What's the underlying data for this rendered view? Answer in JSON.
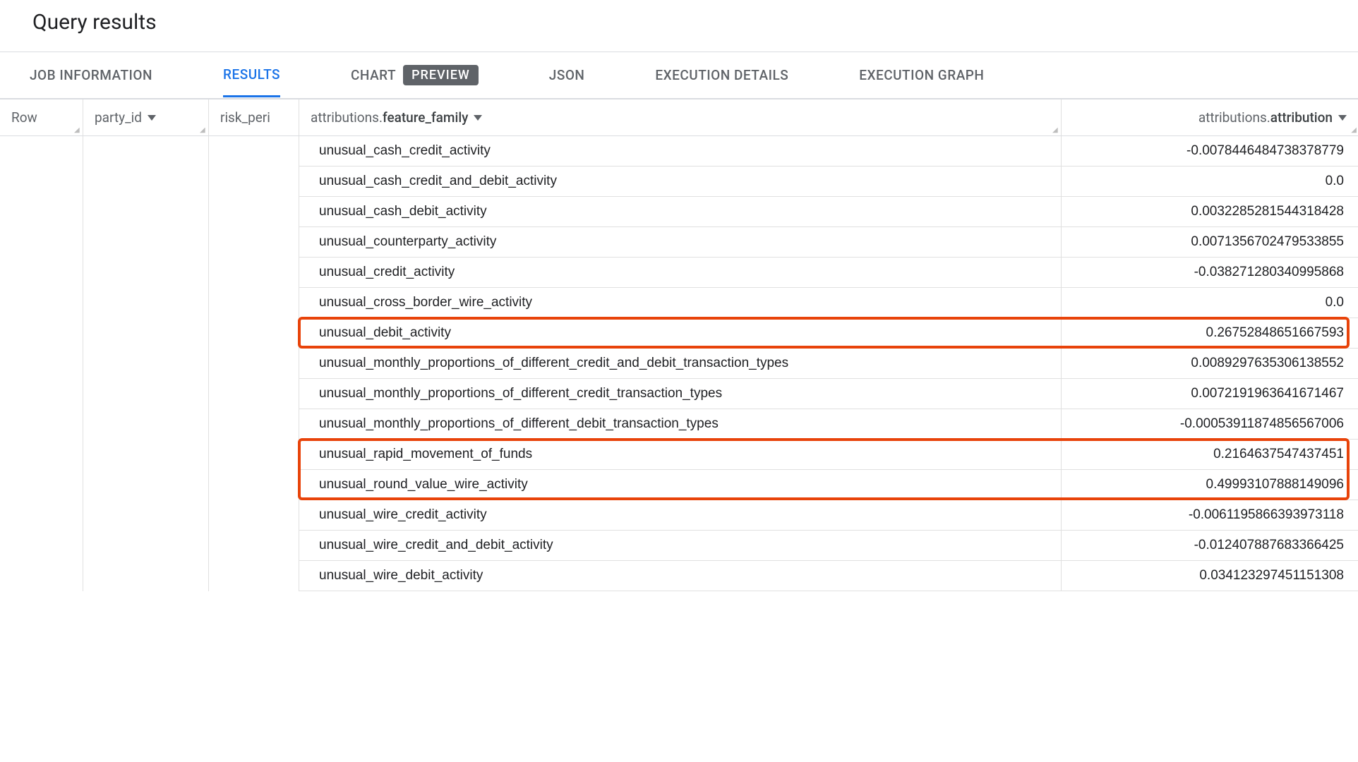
{
  "title": "Query results",
  "tabs": {
    "job_information": "JOB INFORMATION",
    "results": "RESULTS",
    "chart": "CHART",
    "preview_badge": "PREVIEW",
    "json": "JSON",
    "execution_details": "EXECUTION DETAILS",
    "execution_graph": "EXECUTION GRAPH"
  },
  "columns": {
    "row": "Row",
    "party_id": "party_id",
    "risk_peri": "risk_peri",
    "feature_family_prefix": "attributions.",
    "feature_family_bold": "feature_family",
    "attribution_prefix": "attributions.",
    "attribution_bold": "attribution"
  },
  "rows": [
    {
      "feature": "unusual_cash_credit_activity",
      "attr": "-0.0078446484738378779"
    },
    {
      "feature": "unusual_cash_credit_and_debit_activity",
      "attr": "0.0"
    },
    {
      "feature": "unusual_cash_debit_activity",
      "attr": "0.0032285281544318428"
    },
    {
      "feature": "unusual_counterparty_activity",
      "attr": "0.0071356702479533855"
    },
    {
      "feature": "unusual_credit_activity",
      "attr": "-0.038271280340995868"
    },
    {
      "feature": "unusual_cross_border_wire_activity",
      "attr": "0.0"
    },
    {
      "feature": "unusual_debit_activity",
      "attr": "0.26752848651667593",
      "hl": 1
    },
    {
      "feature": "unusual_monthly_proportions_of_different_credit_and_debit_transaction_types",
      "attr": "0.0089297635306138552"
    },
    {
      "feature": "unusual_monthly_proportions_of_different_credit_transaction_types",
      "attr": "0.0072191963641671467"
    },
    {
      "feature": "unusual_monthly_proportions_of_different_debit_transaction_types",
      "attr": "-0.00053911874856567006"
    },
    {
      "feature": "unusual_rapid_movement_of_funds",
      "attr": "0.2164637547437451",
      "hl": 2
    },
    {
      "feature": "unusual_round_value_wire_activity",
      "attr": "0.49993107888149096",
      "hl": 2
    },
    {
      "feature": "unusual_wire_credit_activity",
      "attr": "-0.0061195866393973118"
    },
    {
      "feature": "unusual_wire_credit_and_debit_activity",
      "attr": "-0.012407887683366425"
    },
    {
      "feature": "unusual_wire_debit_activity",
      "attr": "0.034123297451151308"
    }
  ]
}
